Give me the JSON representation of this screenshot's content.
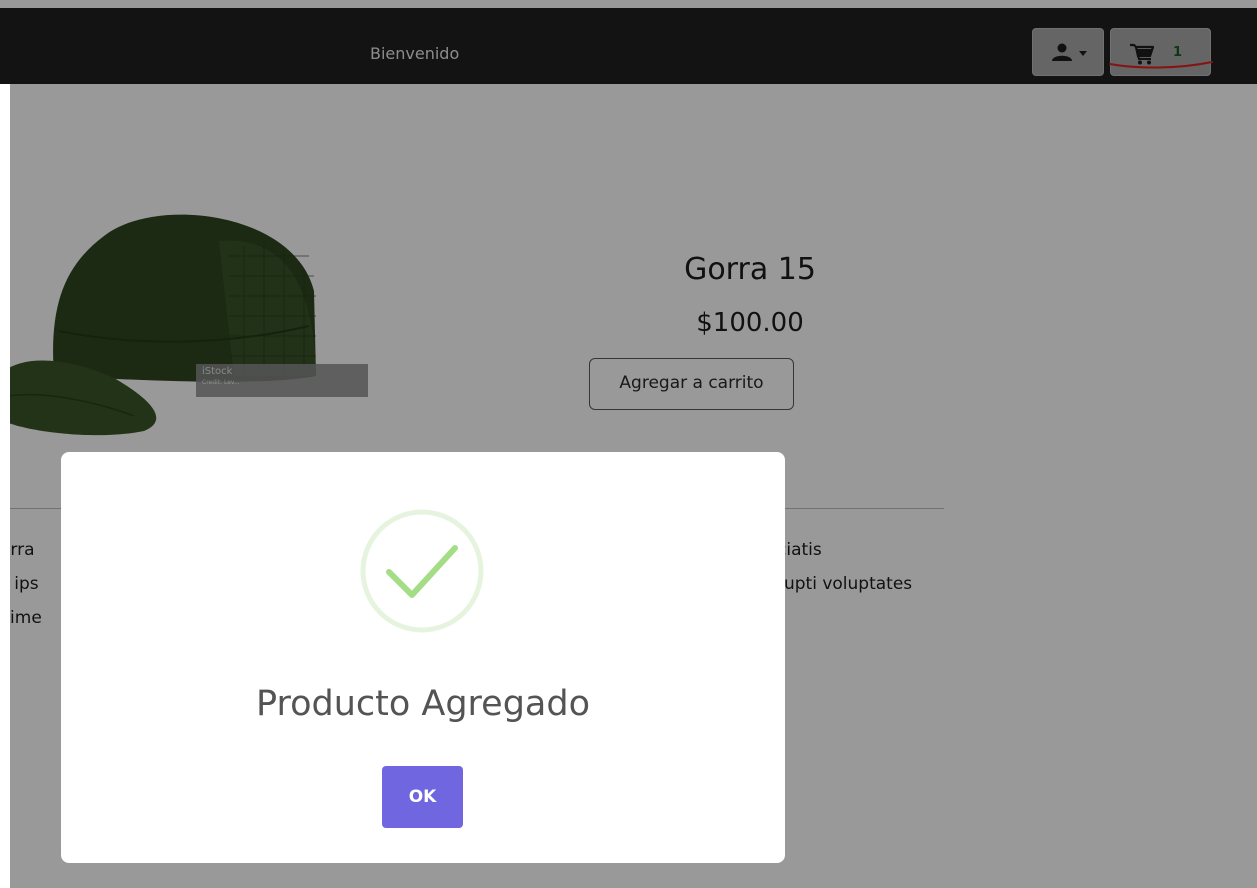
{
  "navbar": {
    "welcome_text": "Bienvenido",
    "user_menu_icon": "user-icon",
    "cart_icon": "cart-icon",
    "cart_count": "1"
  },
  "product": {
    "name": "Gorra 15",
    "price": "$100.00",
    "add_to_cart_label": "Agregar a carrito",
    "image_watermark": "iStock",
    "image_watermark_credit": "Credit: Lev..."
  },
  "description": {
    "left_fragments": [
      "orra",
      "s ips",
      "xime"
    ],
    "right_fragments": [
      "ciatis",
      "rupti voluptates"
    ]
  },
  "modal": {
    "icon": "success-check-icon",
    "title": "Producto Agregado",
    "ok_label": "OK"
  },
  "colors": {
    "navbar_bg": "#212121",
    "overlay": "rgba(0,0,0,0.4)",
    "ok_button": "#7066e0",
    "success_green": "#a5dc86",
    "cart_count": "#1a5c22",
    "annotation_red": "#e02020"
  }
}
